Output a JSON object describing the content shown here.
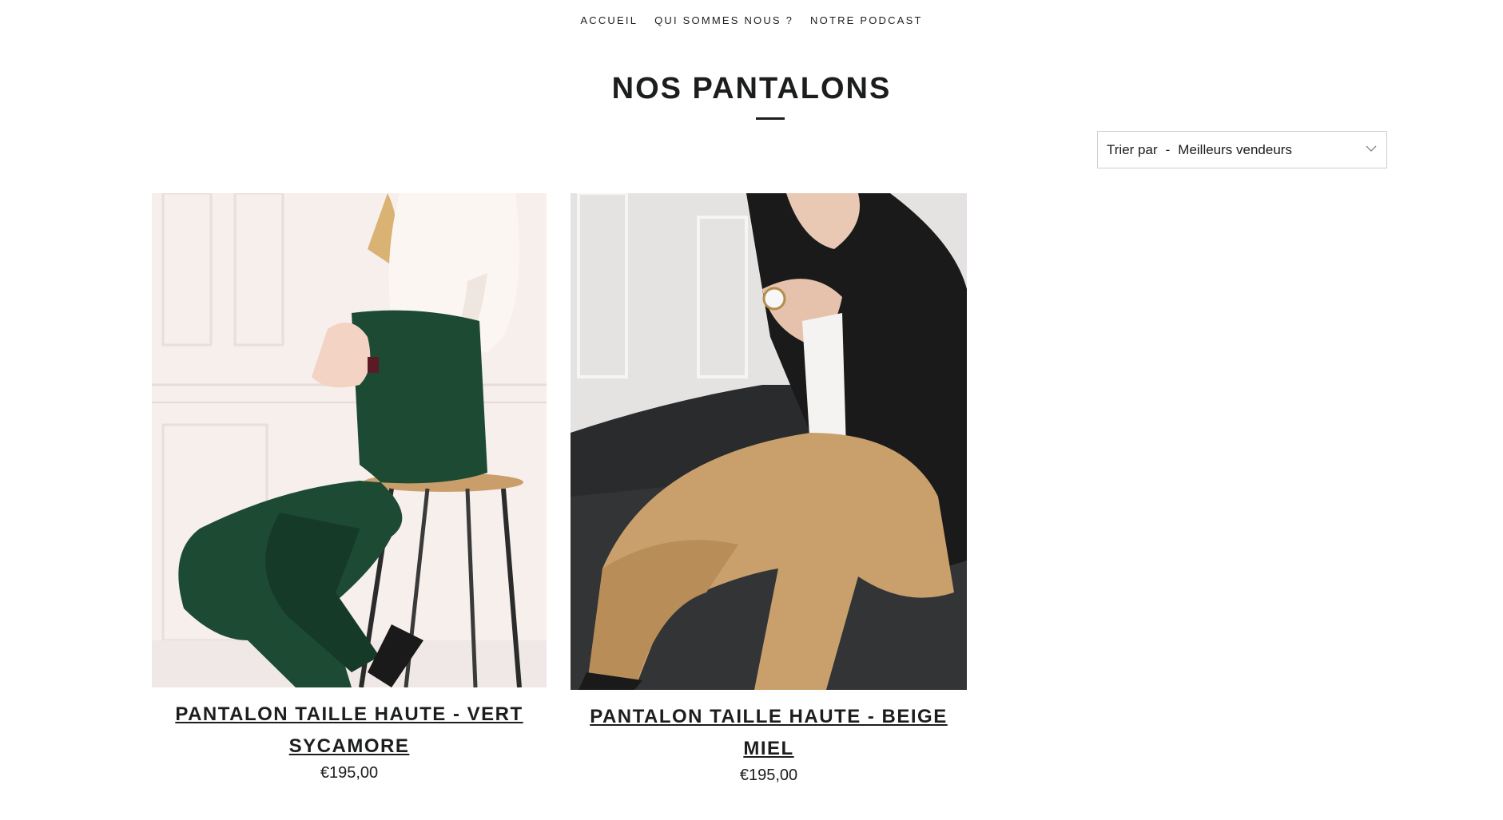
{
  "nav": {
    "items": [
      {
        "label": "ACCUEIL"
      },
      {
        "label": "QUI SOMMES NOUS ?"
      },
      {
        "label": "NOTRE PODCAST"
      }
    ]
  },
  "collection": {
    "title": "NOS PANTALONS"
  },
  "sort": {
    "label": "Trier par",
    "separator": "-",
    "selected": "Meilleurs vendeurs",
    "icon": "chevron-down-icon"
  },
  "products": [
    {
      "name": "PANTALON TAILLE HAUTE - VERT SYCAMORE",
      "price": "€195,00",
      "image": "woman-green-trousers-photo"
    },
    {
      "name": "PANTALON TAILLE HAUTE - BEIGE MIEL",
      "price": "€195,00",
      "image": "woman-beige-trousers-photo"
    }
  ],
  "colors": {
    "text": "#1c1d1d",
    "border": "#cfcfcf",
    "green_trousers": "#1d4a33",
    "beige_trousers": "#c9a06c",
    "black_blazer": "#1a1a1a"
  }
}
